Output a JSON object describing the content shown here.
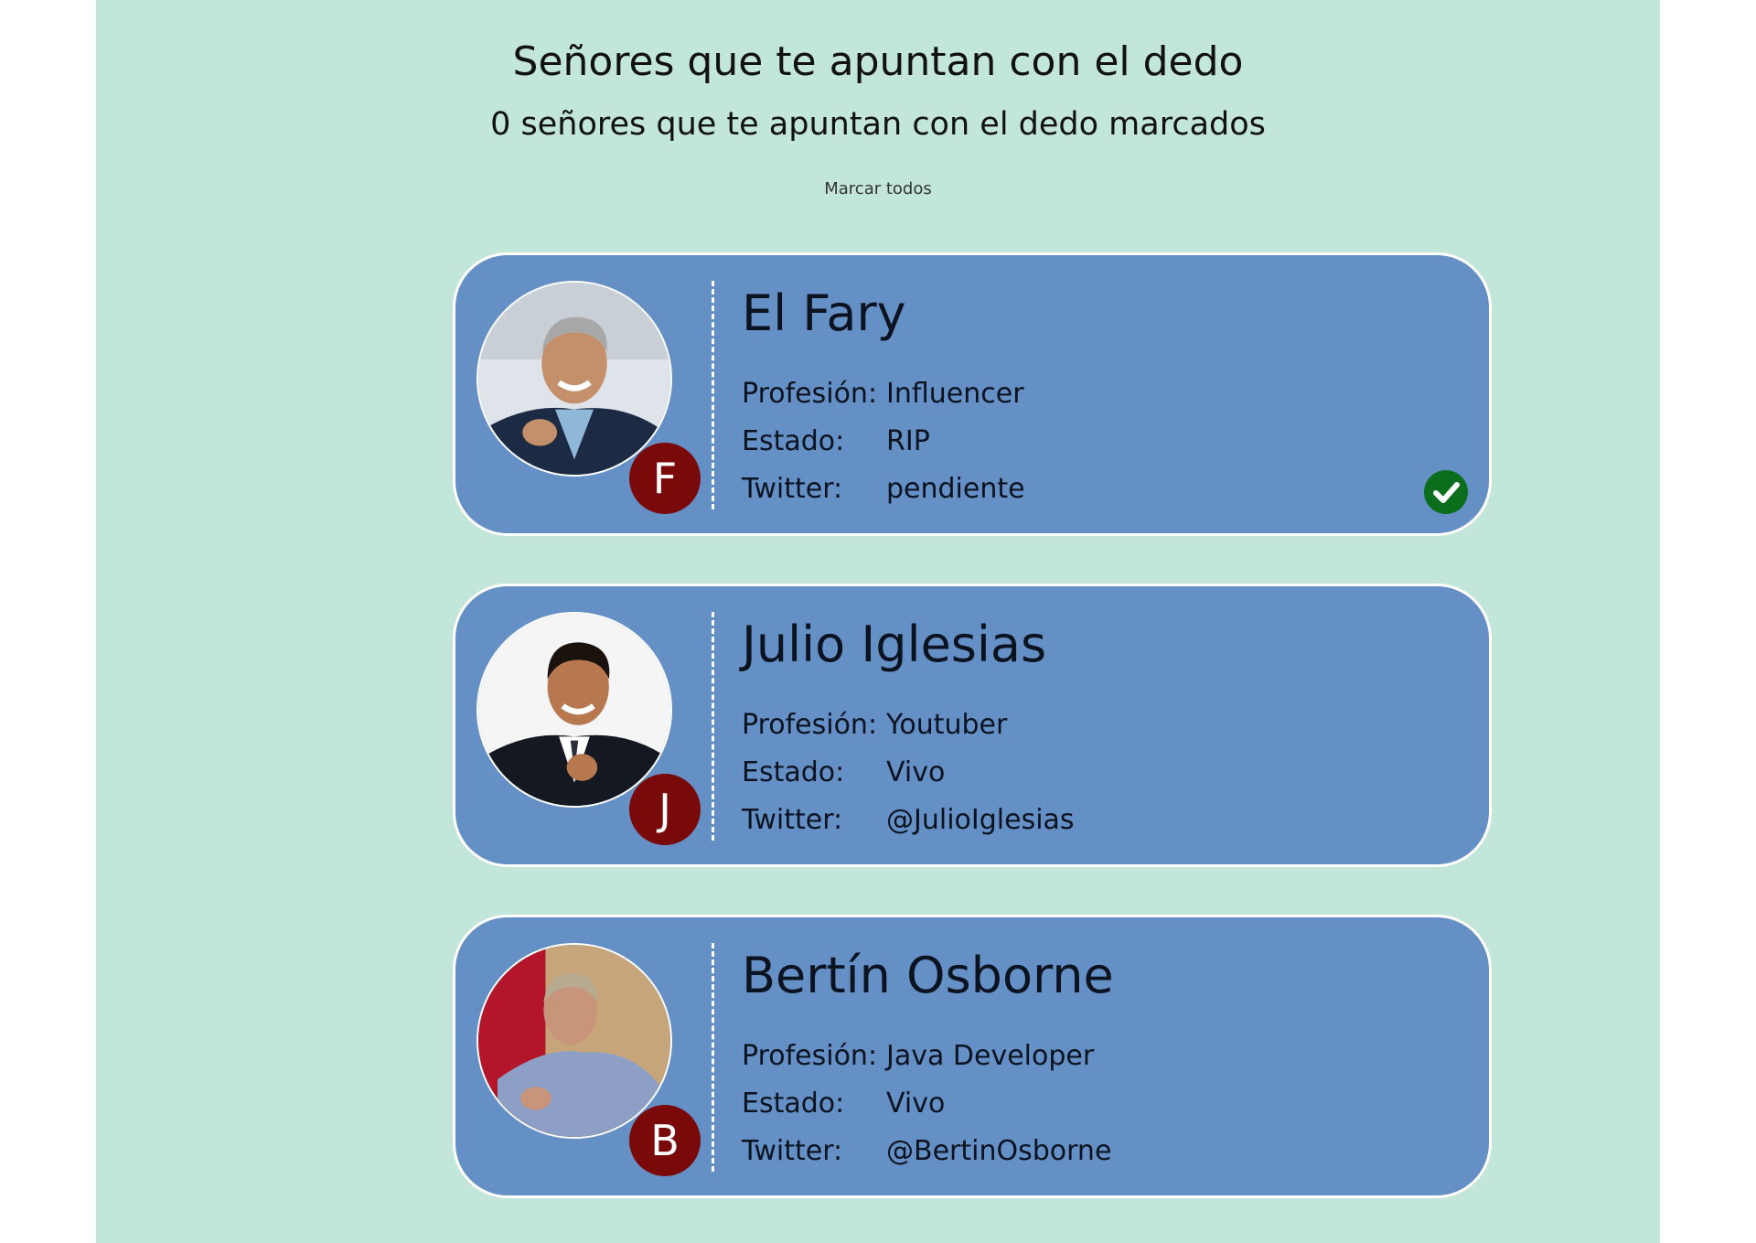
{
  "header": {
    "title": "Señores que te apuntan con el dedo",
    "subtitle": "0 señores que te apuntan con el dedo marcados",
    "mark_all": "Marcar todos"
  },
  "labels": {
    "profession": "Profesión:",
    "status": "Estado:",
    "twitter": "Twitter:"
  },
  "people": [
    {
      "name": "El Fary",
      "initial": "F",
      "profession": "Influencer",
      "status": "RIP",
      "twitter": "pendiente",
      "marked": true
    },
    {
      "name": "Julio Iglesias",
      "initial": "J",
      "profession": "Youtuber",
      "status": "Vivo",
      "twitter": "@JulioIglesias",
      "marked": false
    },
    {
      "name": "Bertín Osborne",
      "initial": "B",
      "profession": "Java Developer",
      "status": "Vivo",
      "twitter": "@BertinOsborne",
      "marked": false
    }
  ],
  "colors": {
    "background": "#c2e6da",
    "card": "#6490c5",
    "initial_badge": "#7a0a0a",
    "check": "#0a6e1d"
  },
  "icons": {
    "check": "check-circle-icon"
  }
}
